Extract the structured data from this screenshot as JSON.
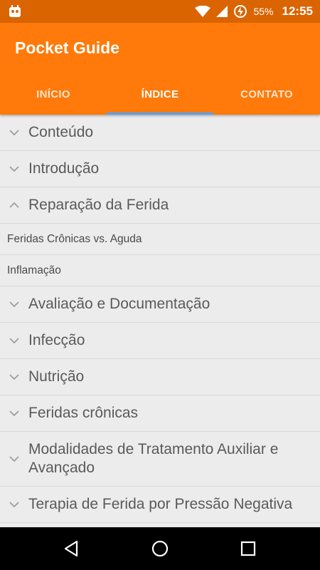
{
  "status": {
    "battery": "55%",
    "time": "12:55"
  },
  "app": {
    "title": "Pocket Guide"
  },
  "tabs": [
    {
      "label": "INÍCIO"
    },
    {
      "label": "ÍNDICE"
    },
    {
      "label": "CONTATO"
    }
  ],
  "items": [
    {
      "label": "Conteúdo"
    },
    {
      "label": "Introdução"
    },
    {
      "label": "Reparação da Ferida"
    },
    {
      "label": "Feridas Crônicas vs. Aguda"
    },
    {
      "label": "Inflamação"
    },
    {
      "label": "Avaliação e Documentação"
    },
    {
      "label": "Infecção"
    },
    {
      "label": "Nutrição"
    },
    {
      "label": "Feridas crônicas"
    },
    {
      "label": "Modalidades de Tratamento Auxiliar e Avançado"
    },
    {
      "label": "Terapia de Ferida por Pressão Negativa"
    }
  ]
}
